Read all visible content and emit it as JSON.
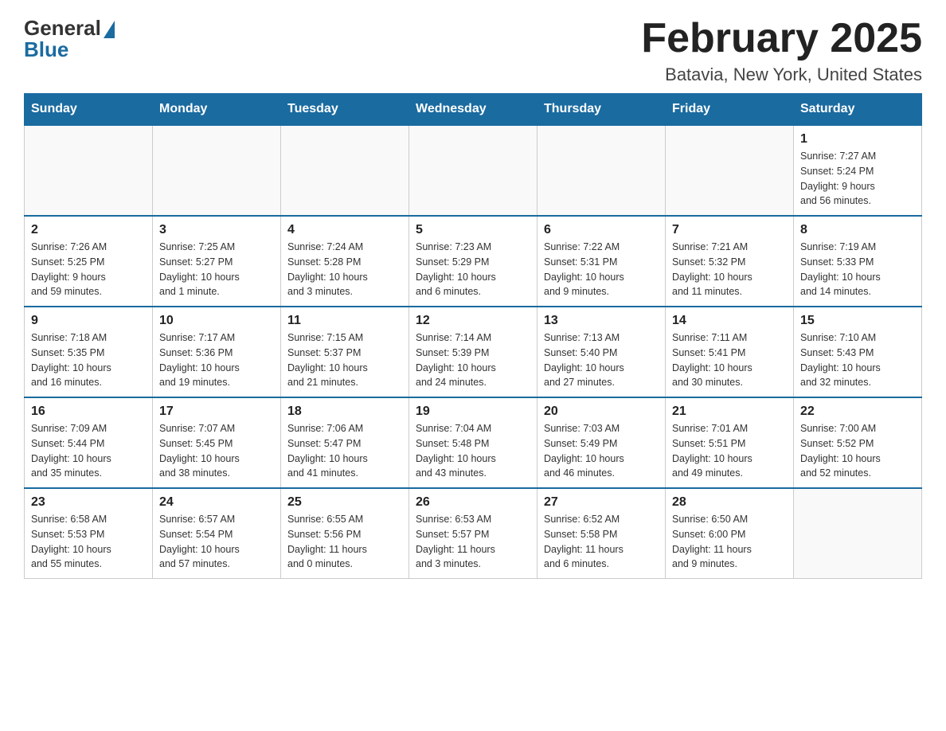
{
  "header": {
    "logo_general": "General",
    "logo_blue": "Blue",
    "month_title": "February 2025",
    "location": "Batavia, New York, United States"
  },
  "weekdays": [
    "Sunday",
    "Monday",
    "Tuesday",
    "Wednesday",
    "Thursday",
    "Friday",
    "Saturday"
  ],
  "weeks": [
    [
      {
        "day": "",
        "info": ""
      },
      {
        "day": "",
        "info": ""
      },
      {
        "day": "",
        "info": ""
      },
      {
        "day": "",
        "info": ""
      },
      {
        "day": "",
        "info": ""
      },
      {
        "day": "",
        "info": ""
      },
      {
        "day": "1",
        "info": "Sunrise: 7:27 AM\nSunset: 5:24 PM\nDaylight: 9 hours\nand 56 minutes."
      }
    ],
    [
      {
        "day": "2",
        "info": "Sunrise: 7:26 AM\nSunset: 5:25 PM\nDaylight: 9 hours\nand 59 minutes."
      },
      {
        "day": "3",
        "info": "Sunrise: 7:25 AM\nSunset: 5:27 PM\nDaylight: 10 hours\nand 1 minute."
      },
      {
        "day": "4",
        "info": "Sunrise: 7:24 AM\nSunset: 5:28 PM\nDaylight: 10 hours\nand 3 minutes."
      },
      {
        "day": "5",
        "info": "Sunrise: 7:23 AM\nSunset: 5:29 PM\nDaylight: 10 hours\nand 6 minutes."
      },
      {
        "day": "6",
        "info": "Sunrise: 7:22 AM\nSunset: 5:31 PM\nDaylight: 10 hours\nand 9 minutes."
      },
      {
        "day": "7",
        "info": "Sunrise: 7:21 AM\nSunset: 5:32 PM\nDaylight: 10 hours\nand 11 minutes."
      },
      {
        "day": "8",
        "info": "Sunrise: 7:19 AM\nSunset: 5:33 PM\nDaylight: 10 hours\nand 14 minutes."
      }
    ],
    [
      {
        "day": "9",
        "info": "Sunrise: 7:18 AM\nSunset: 5:35 PM\nDaylight: 10 hours\nand 16 minutes."
      },
      {
        "day": "10",
        "info": "Sunrise: 7:17 AM\nSunset: 5:36 PM\nDaylight: 10 hours\nand 19 minutes."
      },
      {
        "day": "11",
        "info": "Sunrise: 7:15 AM\nSunset: 5:37 PM\nDaylight: 10 hours\nand 21 minutes."
      },
      {
        "day": "12",
        "info": "Sunrise: 7:14 AM\nSunset: 5:39 PM\nDaylight: 10 hours\nand 24 minutes."
      },
      {
        "day": "13",
        "info": "Sunrise: 7:13 AM\nSunset: 5:40 PM\nDaylight: 10 hours\nand 27 minutes."
      },
      {
        "day": "14",
        "info": "Sunrise: 7:11 AM\nSunset: 5:41 PM\nDaylight: 10 hours\nand 30 minutes."
      },
      {
        "day": "15",
        "info": "Sunrise: 7:10 AM\nSunset: 5:43 PM\nDaylight: 10 hours\nand 32 minutes."
      }
    ],
    [
      {
        "day": "16",
        "info": "Sunrise: 7:09 AM\nSunset: 5:44 PM\nDaylight: 10 hours\nand 35 minutes."
      },
      {
        "day": "17",
        "info": "Sunrise: 7:07 AM\nSunset: 5:45 PM\nDaylight: 10 hours\nand 38 minutes."
      },
      {
        "day": "18",
        "info": "Sunrise: 7:06 AM\nSunset: 5:47 PM\nDaylight: 10 hours\nand 41 minutes."
      },
      {
        "day": "19",
        "info": "Sunrise: 7:04 AM\nSunset: 5:48 PM\nDaylight: 10 hours\nand 43 minutes."
      },
      {
        "day": "20",
        "info": "Sunrise: 7:03 AM\nSunset: 5:49 PM\nDaylight: 10 hours\nand 46 minutes."
      },
      {
        "day": "21",
        "info": "Sunrise: 7:01 AM\nSunset: 5:51 PM\nDaylight: 10 hours\nand 49 minutes."
      },
      {
        "day": "22",
        "info": "Sunrise: 7:00 AM\nSunset: 5:52 PM\nDaylight: 10 hours\nand 52 minutes."
      }
    ],
    [
      {
        "day": "23",
        "info": "Sunrise: 6:58 AM\nSunset: 5:53 PM\nDaylight: 10 hours\nand 55 minutes."
      },
      {
        "day": "24",
        "info": "Sunrise: 6:57 AM\nSunset: 5:54 PM\nDaylight: 10 hours\nand 57 minutes."
      },
      {
        "day": "25",
        "info": "Sunrise: 6:55 AM\nSunset: 5:56 PM\nDaylight: 11 hours\nand 0 minutes."
      },
      {
        "day": "26",
        "info": "Sunrise: 6:53 AM\nSunset: 5:57 PM\nDaylight: 11 hours\nand 3 minutes."
      },
      {
        "day": "27",
        "info": "Sunrise: 6:52 AM\nSunset: 5:58 PM\nDaylight: 11 hours\nand 6 minutes."
      },
      {
        "day": "28",
        "info": "Sunrise: 6:50 AM\nSunset: 6:00 PM\nDaylight: 11 hours\nand 9 minutes."
      },
      {
        "day": "",
        "info": ""
      }
    ]
  ]
}
